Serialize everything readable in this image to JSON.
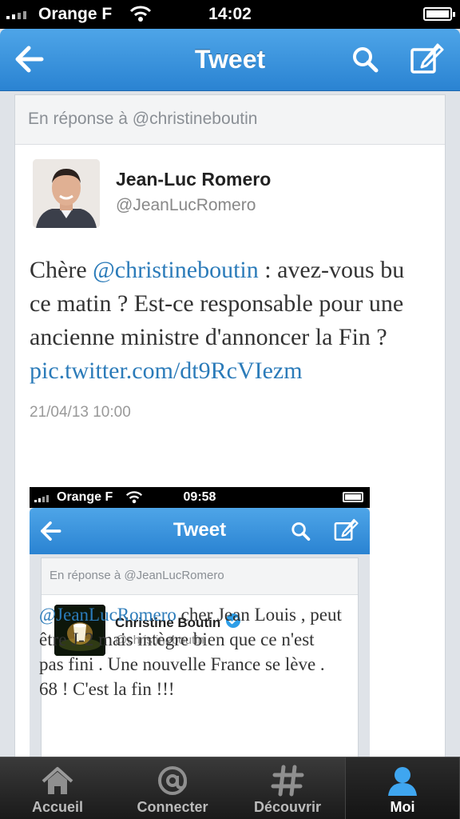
{
  "status_bar": {
    "carrier": "Orange F",
    "time": "14:02"
  },
  "nav": {
    "title": "Tweet"
  },
  "tweet": {
    "reply_context": "En réponse à @christineboutin",
    "author_name": "Jean-Luc Romero",
    "author_handle": "@JeanLucRomero",
    "text_before": "Chère ",
    "mention": "@christineboutin",
    "text_after": " : avez-vous bu ce matin ? Est-ce responsable pour une ancienne ministre d'annoncer la Fin ?",
    "link": "pic.twitter.com/dt9RcVIezm",
    "timestamp": "21/04/13 10:00"
  },
  "embedded_screenshot": {
    "carrier": "Orange F",
    "time": "09:58",
    "title": "Tweet",
    "reply_context": "En réponse à @JeanLucRomero",
    "author_name": "Christine Boutin",
    "author_handle": "@christineboutin",
    "mention": "@JeanLucRomero",
    "text": " cher Jean Louis , peut être J-2 mais intègre bien que ce n'est pas fini . Une nouvelle France se lève . 68 ! C'est la fin !!!"
  },
  "tabs": [
    {
      "label": "Accueil",
      "icon": "home-icon"
    },
    {
      "label": "Connecter",
      "icon": "at-icon"
    },
    {
      "label": "Découvrir",
      "icon": "hashtag-icon"
    },
    {
      "label": "Moi",
      "icon": "person-icon",
      "active": true
    }
  ],
  "colors": {
    "accent": "#2b7bb9",
    "nav_blue": "#2a83d2"
  }
}
